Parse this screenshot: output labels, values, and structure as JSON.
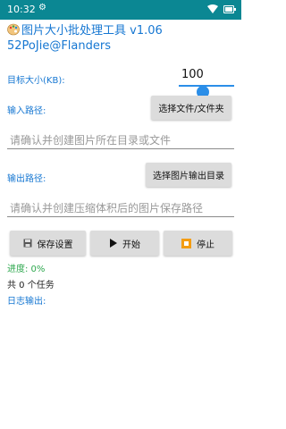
{
  "status_bar": {
    "time": "10:32"
  },
  "app": {
    "title": "图片大小批处理工具 v1.06",
    "author": "52PoJie@Flanders"
  },
  "target_size": {
    "label": "目标大小(KB):",
    "value": "100",
    "slider_level_percent": 40
  },
  "input": {
    "label": "输入路径:",
    "button_label": "选择文件/文件夹",
    "placeholder": "请确认并创建图片所在目录或文件"
  },
  "output": {
    "label": "输出路径:",
    "button_label": "选择图片输出目录",
    "placeholder": "请确认并创建压缩体积后的图片保存路径"
  },
  "actions": {
    "save_label": "保存设置",
    "start_label": "开始",
    "stop_label": "停止"
  },
  "status": {
    "progress": "进度: 0%",
    "tasks": "共 0 个任务",
    "log_label": "日志输出:"
  },
  "colors": {
    "status_bar": "#0b8793",
    "accent": "#1677d2",
    "progress_green": "#2fa84f",
    "button_bg": "#dcdcdc"
  }
}
